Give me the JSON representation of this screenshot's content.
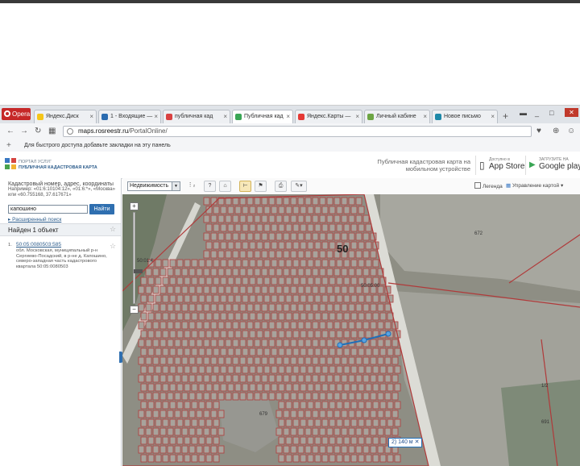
{
  "browser": {
    "menu_label": "Opera",
    "tabs": [
      {
        "label": "Яндекс.Диск",
        "color": "#f5c518"
      },
      {
        "label": "1 - Входящие —",
        "color": "#2b6cb0"
      },
      {
        "label": "публичная кад",
        "color": "#d94141"
      },
      {
        "label": "Публичная кад",
        "color": "#3aa655"
      },
      {
        "label": "Яндекс.Карты —",
        "color": "#e53935"
      },
      {
        "label": "Личный кабине",
        "color": "#6da544"
      },
      {
        "label": "Новое письмо",
        "color": "#1e88a8"
      }
    ],
    "active_tab_index": 3,
    "url_host": "maps.rosreestr.ru",
    "url_path": "/PortalOnline/",
    "bookmarks_hint": "Для быстрого доступа добавьте закладки на эту панель"
  },
  "header": {
    "logo_line1": "ПОРТАЛ УСЛУГ",
    "logo_line2": "ПУБЛИЧНАЯ КАДАСТРОВАЯ КАРТА",
    "mobile_info": "Публичная кадастровая карта на мобильном устройстве",
    "app_store_small": "Доступно в",
    "app_store": "App Store",
    "google_play_small": "ЗАГРУЗИТЕ НА",
    "google_play": "Google play"
  },
  "search": {
    "hint_title": "Кадастровый номер, адрес, координаты",
    "hint_text": "Например: «01:6:10104:12», «01:6:*», «Москва» или «60.755168, 37.617671»",
    "query": "капошино",
    "button": "Найти",
    "advanced": "Расширенный поиск"
  },
  "results": {
    "header": "Найден 1 объект",
    "items": [
      {
        "num": "1.",
        "id": "50:05:0080503:585",
        "desc": "обл. Московская, муниципальный р-н Сергиево-Посадский, в р-не д. Капошино, северо-западная часть кадастрового квартала 50:05:0080503"
      }
    ]
  },
  "toolbar": {
    "layer_select": "Недвижимость",
    "legend_label": "Легенда",
    "layers_label": "Управление картой"
  },
  "map": {
    "region_label": "50",
    "measure_label": "2) 140 м",
    "labels": [
      "672",
      "50:05:00",
      "50:01:4",
      "691",
      "1/2",
      "679"
    ],
    "colors": {
      "parcel": "#b03a3a",
      "land": "#8e8e84",
      "field": "#a7a79f",
      "road": "#dcdcd6",
      "measure": "#1f6fb8"
    }
  }
}
